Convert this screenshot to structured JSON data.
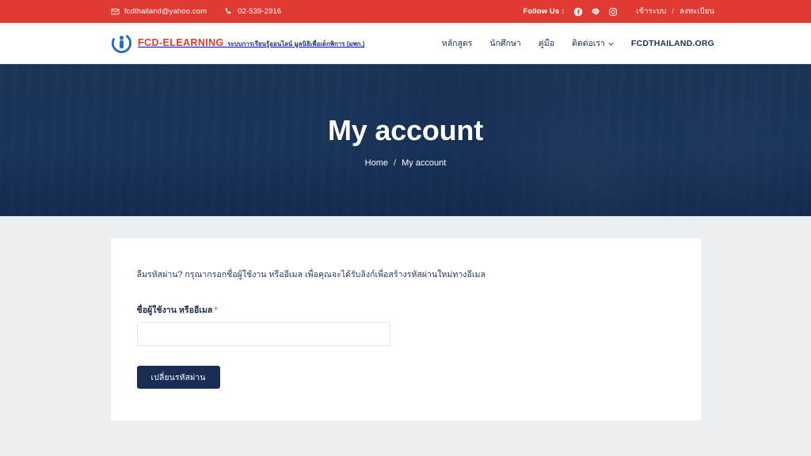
{
  "topbar": {
    "email": "fcdthailand@yahoo.com",
    "email_icon": "envelope-icon",
    "phone": "02-539-2916",
    "phone_icon": "phone-icon",
    "follow_label": "Follow Us :",
    "social": [
      {
        "name": "facebook-icon",
        "label": "Facebook"
      },
      {
        "name": "line-icon",
        "label": "Line"
      },
      {
        "name": "instagram-icon",
        "label": "Instagram"
      }
    ],
    "login": "เข้าระบบ",
    "separator": "/",
    "register": "ลงทะเบียน"
  },
  "brand": {
    "title": "FCD-ELEARNING",
    "subtitle": "ระบบการเรียนรู้ออนไลน์ มูลนิธิเพื่อเด็กพิการ (มพก.)",
    "logo_icon": "fcd-logo-icon"
  },
  "nav": {
    "items": [
      {
        "label": "หลักสูตร",
        "has_dropdown": false,
        "strong": false
      },
      {
        "label": "นักศึกษา",
        "has_dropdown": false,
        "strong": false
      },
      {
        "label": "คู่มือ",
        "has_dropdown": false,
        "strong": false
      },
      {
        "label": "ติดต่อเรา",
        "has_dropdown": true,
        "strong": false
      },
      {
        "label": "FCDTHAILAND.ORG",
        "has_dropdown": false,
        "strong": true
      }
    ]
  },
  "hero": {
    "title": "My account",
    "breadcrumb": {
      "home": "Home",
      "separator": "/",
      "current": "My account"
    }
  },
  "form": {
    "intro": "ลืมรหัสผ่าน? กรุณากรอกชื่อผู้ใช้งาน หรืออีเมล เพื่อคุณจะได้รับลิงก์เพื่อสร้างรหัสผ่านใหม่ทางอีเมล",
    "label": "ชื่อผู้ใช้งาน หรืออีเมล",
    "required_mark": "*",
    "input_value": "",
    "input_placeholder": "",
    "submit_label": "เปลี่ยนรหัสผ่าน"
  },
  "colors": {
    "topbar_red": "#e03a32",
    "brand_red": "#d93c33",
    "navy": "#1a2d57",
    "hero_navy": "#132d54",
    "page_bg": "#eceff2"
  }
}
